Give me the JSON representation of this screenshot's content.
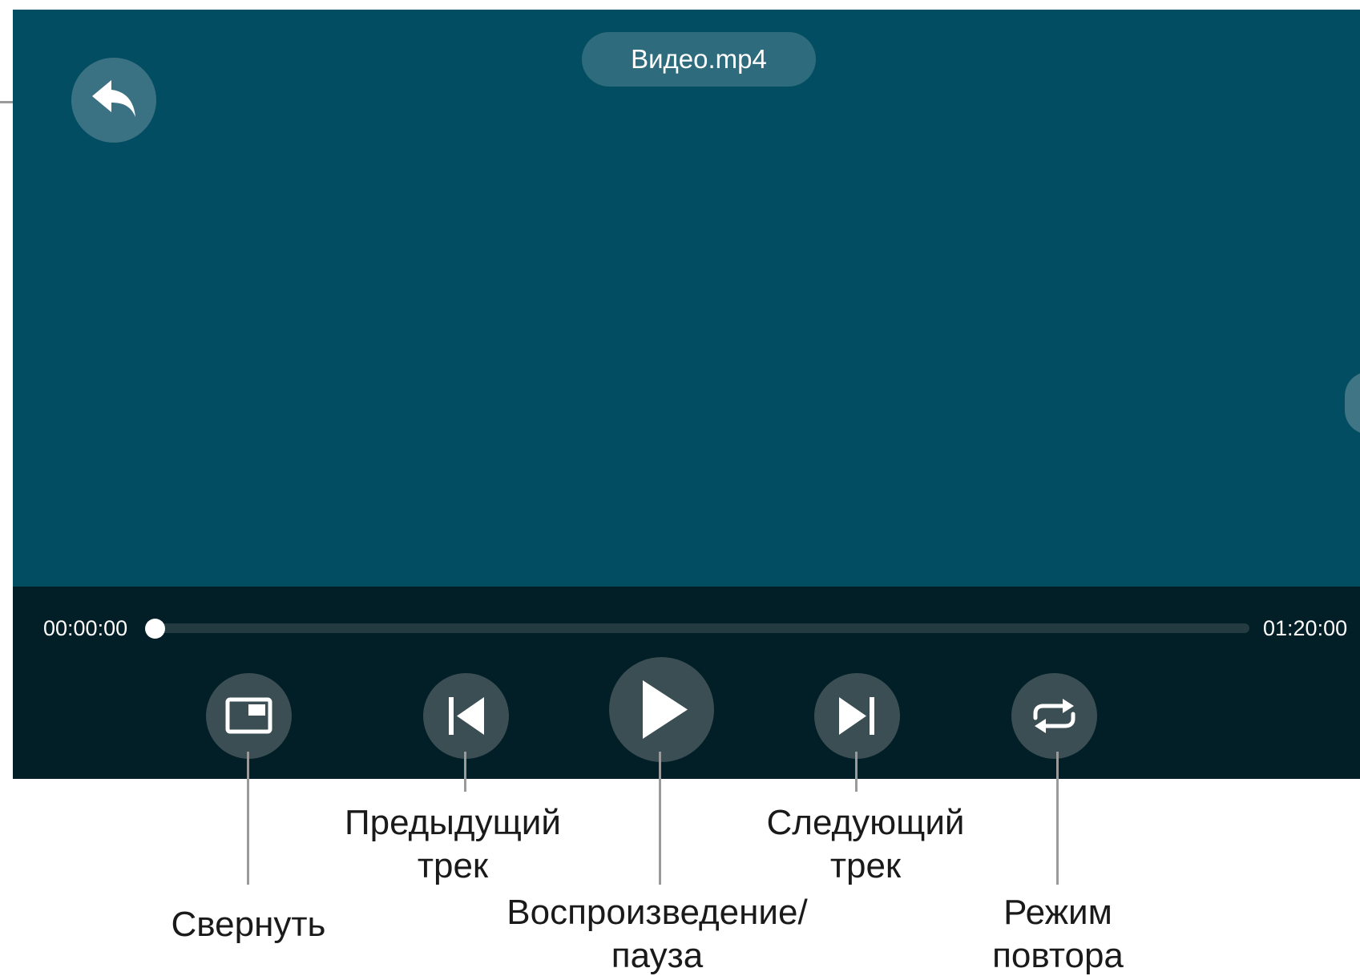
{
  "player": {
    "file_title": "Видео.mp4",
    "time_current": "00:00:00",
    "time_total": "01:20:00",
    "progress_fraction": 0,
    "controls": {
      "back_icon": "back-arrow-icon",
      "minimize_icon": "picture-in-picture-icon",
      "prev_icon": "skip-previous-icon",
      "play_icon": "play-icon",
      "next_icon": "skip-next-icon",
      "repeat_icon": "repeat-icon"
    }
  },
  "callouts": {
    "minimize": "Свернуть",
    "previous_line1": "Предыдущий",
    "previous_line2": "трек",
    "play_line1": "Воспроизведение/",
    "play_line2": "пауза",
    "next_line1": "Следующий",
    "next_line2": "трек",
    "repeat_line1": "Режим",
    "repeat_line2": "повтора"
  },
  "colors": {
    "screen_bg": "#024d62",
    "control_bar_bg": "#021e26",
    "button_bg": "#3a4e54",
    "pill_bg": "#2e6c7d",
    "leader_line": "#9a9a9a"
  }
}
